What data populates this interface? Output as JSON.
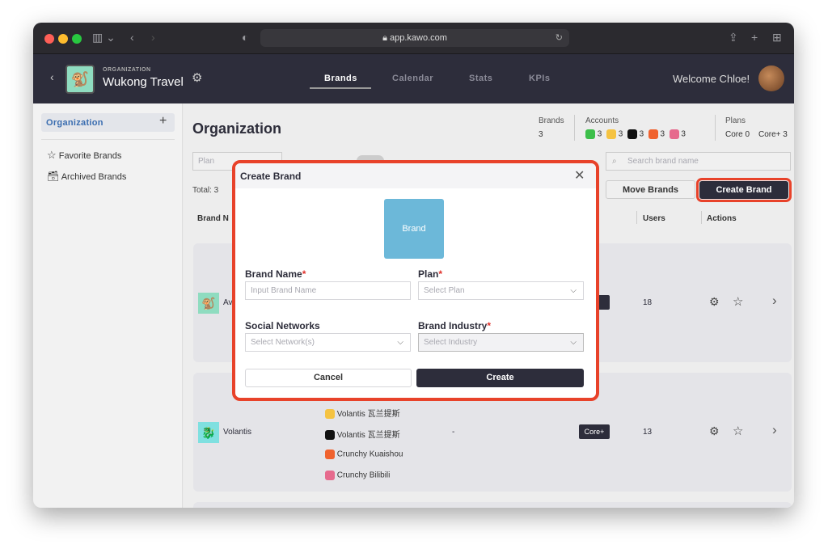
{
  "browser": {
    "url": "app.kawo.com"
  },
  "header": {
    "org_label": "ORGANIZATION",
    "org_name": "Wukong Travel",
    "tabs": [
      {
        "label": "Brands"
      },
      {
        "label": "Calendar"
      },
      {
        "label": "Stats"
      },
      {
        "label": "KPIs"
      }
    ],
    "welcome": "Welcome Chloe!"
  },
  "sidebar": {
    "section": "Organization",
    "items": [
      {
        "label": "Favorite Brands",
        "icon": "star-icon"
      },
      {
        "label": "Archived Brands",
        "icon": "archive-icon"
      }
    ]
  },
  "main": {
    "title": "Organization",
    "stats": {
      "brands_label": "Brands",
      "brands_value": "3",
      "accounts_label": "Accounts",
      "accounts": [
        {
          "network": "wechat",
          "count": "3",
          "color": "#3dbf4a"
        },
        {
          "network": "weibo",
          "count": "3",
          "color": "#f5c342"
        },
        {
          "network": "douyin",
          "count": "3",
          "color": "#111111"
        },
        {
          "network": "kuaishou",
          "count": "3",
          "color": "#f0622e"
        },
        {
          "network": "bilibili",
          "count": "3",
          "color": "#e66a8d"
        }
      ],
      "plans_label": "Plans",
      "plans": [
        "Core 0",
        "Core+ 3"
      ]
    },
    "filter_plan_placeholder": "Plan",
    "total": "Total: 3",
    "search_placeholder": "Search brand name",
    "move_brands": "Move Brands",
    "create_brand": "Create Brand",
    "columns": {
      "brand_name": "Brand N",
      "users": "Users",
      "actions": "Actions"
    },
    "rows": [
      {
        "name": "Av",
        "users": "18"
      },
      {
        "name": "Volantis",
        "accounts": [
          "Volantis 瓦兰提斯",
          "Volantis 瓦兰提斯",
          "Crunchy Kuaishou",
          "Crunchy Bilibili"
        ],
        "industry": "-",
        "plan": "Core+",
        "users": "13"
      }
    ]
  },
  "modal": {
    "title": "Create Brand",
    "logo_text": "Brand",
    "brand_name_label": "Brand Name",
    "brand_name_placeholder": "Input Brand Name",
    "plan_label": "Plan",
    "plan_placeholder": "Select Plan",
    "networks_label": "Social Networks",
    "networks_placeholder": "Select Network(s)",
    "industry_label": "Brand Industry",
    "industry_placeholder": "Select Industry",
    "required_mark": "*",
    "cancel": "Cancel",
    "create": "Create"
  },
  "colors": {
    "highlight": "#e8422a",
    "dark": "#2d2d3b",
    "brand_tile": "#6cb8d9",
    "sidebar_active": "#3a6db0"
  }
}
